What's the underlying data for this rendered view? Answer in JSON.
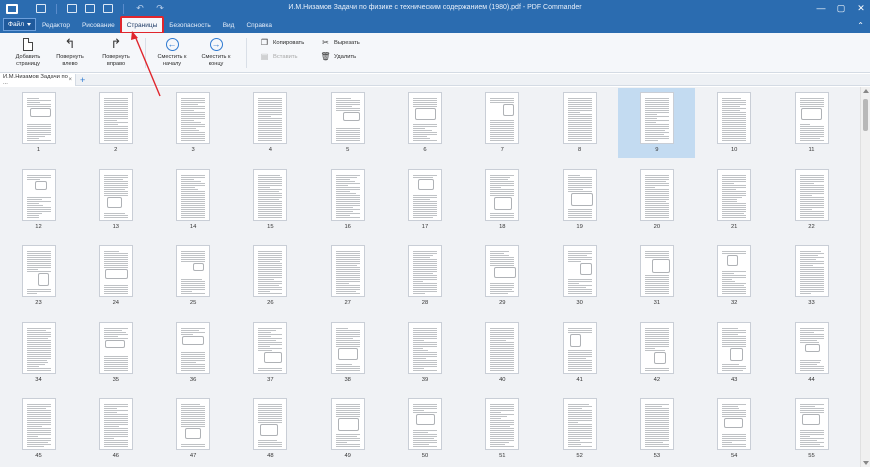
{
  "window": {
    "title": "И.М.Низамов Задачи по физике с техническим содержанием (1980).pdf - PDF Commander",
    "minimize": "—",
    "maximize": "▢",
    "close": "✕"
  },
  "ribbon_tabs": {
    "file": "Файл",
    "tabs": [
      "Редактор",
      "Рисование",
      "Страницы",
      "Безопасность",
      "Вид",
      "Справка"
    ],
    "active": "Страницы",
    "highlight_color": "#e0262d",
    "collapse": "⌃"
  },
  "ribbon": {
    "add_page": "Добавить страницу",
    "rotate_left": "Повернуть влево",
    "rotate_right": "Повернуть вправо",
    "move_to_start": "Сместить к началу",
    "move_to_end": "Сместить к концу",
    "copy": "Копировать",
    "paste": "Вставить",
    "cut": "Вырезать",
    "delete": "Удалить"
  },
  "doc_tab": {
    "label": "И.М.Низамов Задачи по ...",
    "close": "×",
    "add": "+"
  },
  "pages": {
    "numbers": [
      1,
      2,
      3,
      4,
      5,
      6,
      7,
      8,
      9,
      10,
      11,
      12,
      13,
      14,
      15,
      16,
      17,
      18,
      19,
      20,
      21,
      22,
      23,
      24,
      25,
      26,
      27,
      28,
      29,
      30,
      31,
      32,
      33,
      34,
      35,
      36,
      37,
      38,
      39,
      40,
      41,
      42,
      43,
      44,
      45,
      46,
      47,
      48,
      49,
      50,
      51,
      52,
      53,
      54,
      55
    ],
    "selected": 9
  },
  "colors": {
    "title_bar": "#2b6cb0",
    "selection": "#c3dbf1",
    "accent": "#2f7ad1"
  }
}
